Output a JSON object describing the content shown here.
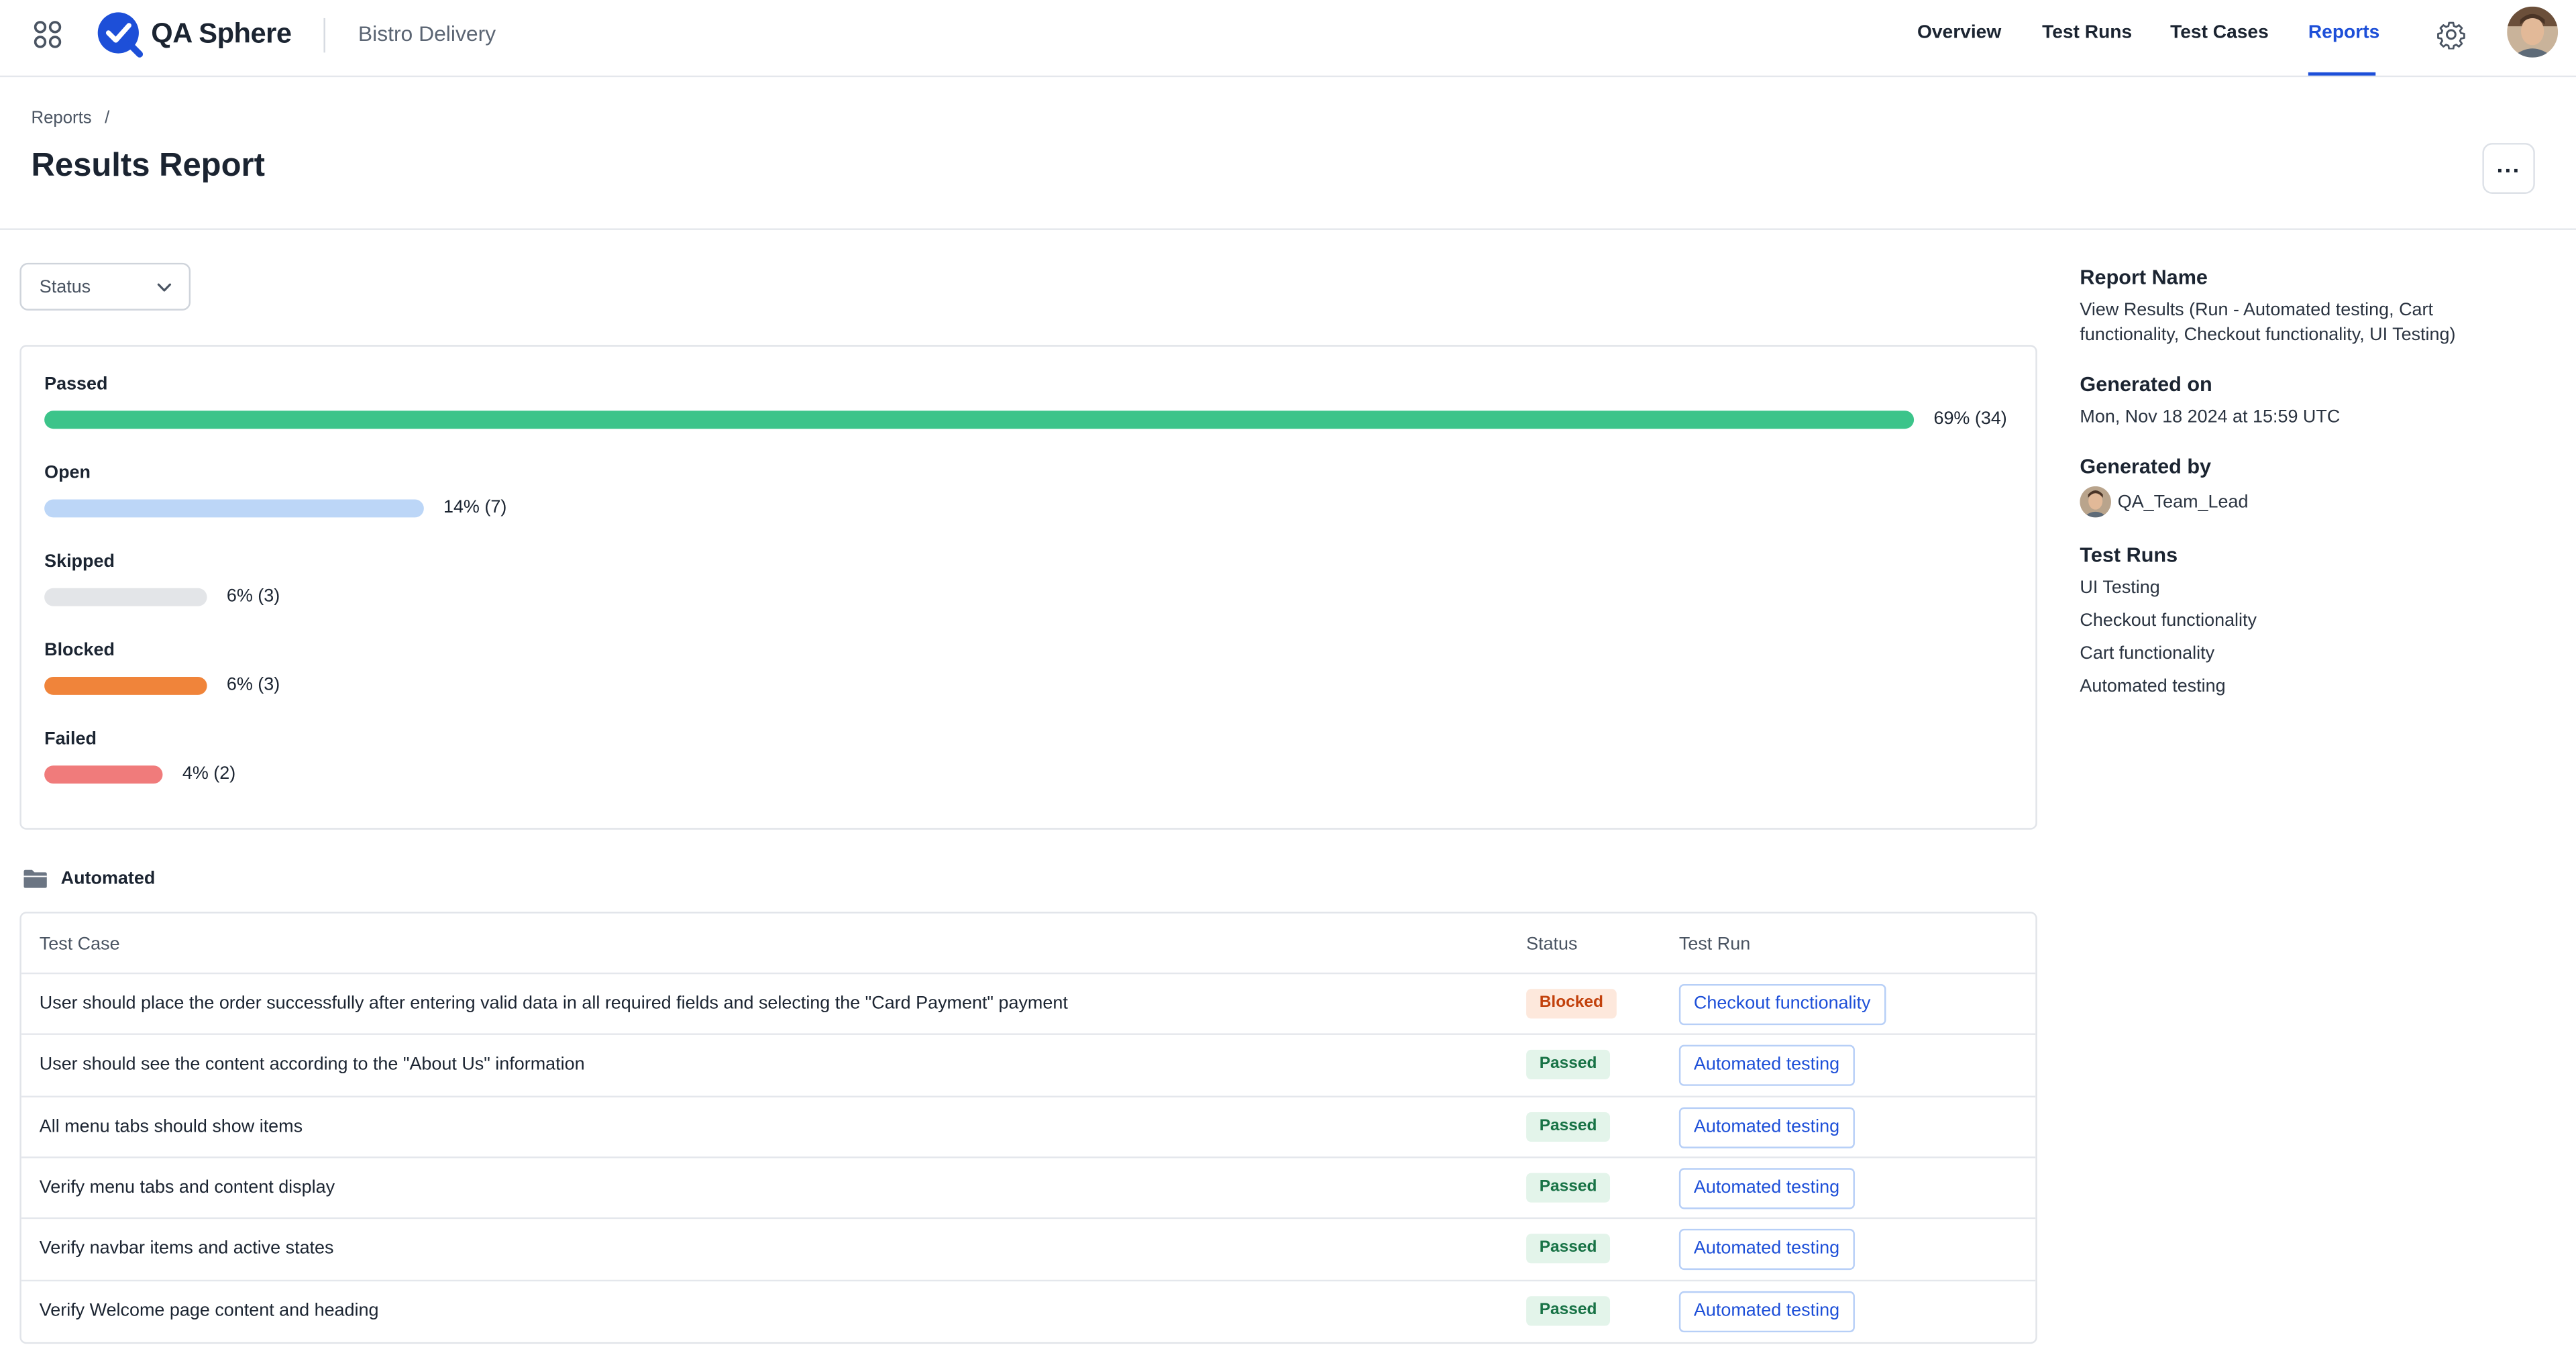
{
  "app": {
    "logo_text": "QA Sphere",
    "project": "Bistro Delivery"
  },
  "nav": {
    "items": [
      {
        "label": "Overview"
      },
      {
        "label": "Test Runs"
      },
      {
        "label": "Test Cases"
      },
      {
        "label": "Reports",
        "active": true
      }
    ]
  },
  "breadcrumb": {
    "items": [
      "Reports"
    ],
    "separator": "/"
  },
  "page": {
    "title": "Results Report"
  },
  "filter": {
    "status_label": "Status"
  },
  "chart_data": {
    "type": "bar",
    "categories": [
      "Passed",
      "Open",
      "Skipped",
      "Blocked",
      "Failed"
    ],
    "values": [
      34,
      7,
      3,
      3,
      2
    ],
    "percents": [
      69,
      14,
      6,
      6,
      4
    ],
    "value_labels": [
      "69% (34)",
      "14% (7)",
      "6% (3)",
      "6% (3)",
      "4% (2)"
    ],
    "colors": [
      "#3cc48a",
      "#bcd6f7",
      "#e3e5e8",
      "#f0843a",
      "#f07b7b"
    ],
    "orientation": "horizontal"
  },
  "folder": {
    "name": "Automated",
    "icon": "folder-icon"
  },
  "table": {
    "headers": [
      "Test Case",
      "Status",
      "Test Run"
    ],
    "rows": [
      {
        "name": "User should place the order successfully after entering valid data in all required fields and selecting the \"Card Payment\" payment",
        "status": "Blocked",
        "run": "Checkout functionality"
      },
      {
        "name": "User should see the content according to the \"About Us\" information",
        "status": "Passed",
        "run": "Automated testing"
      },
      {
        "name": "All menu tabs should show items",
        "status": "Passed",
        "run": "Automated testing"
      },
      {
        "name": "Verify menu tabs and content display",
        "status": "Passed",
        "run": "Automated testing"
      },
      {
        "name": "Verify navbar items and active states",
        "status": "Passed",
        "run": "Automated testing"
      },
      {
        "name": "Verify Welcome page content and heading",
        "status": "Passed",
        "run": "Automated testing"
      }
    ]
  },
  "sidebar": {
    "report_name_label": "Report Name",
    "report_name_line1": "View Results (Run - Automated testing, Cart",
    "report_name_line2": "functionality, Checkout functionality, UI Testing)",
    "generated_on_label": "Generated on",
    "generated_on": "Mon, Nov 18 2024 at 15:59 UTC",
    "generated_by_label": "Generated by",
    "generated_by": "QA_Team_Lead",
    "test_runs_label": "Test Runs",
    "test_runs": [
      "UI Testing",
      "Checkout functionality",
      "Cart functionality",
      "Automated testing"
    ]
  },
  "colors": {
    "accent": "#1d4fd8",
    "passed_badge_bg": "#e3f4ea",
    "blocked_badge_bg": "#fde8dc"
  }
}
